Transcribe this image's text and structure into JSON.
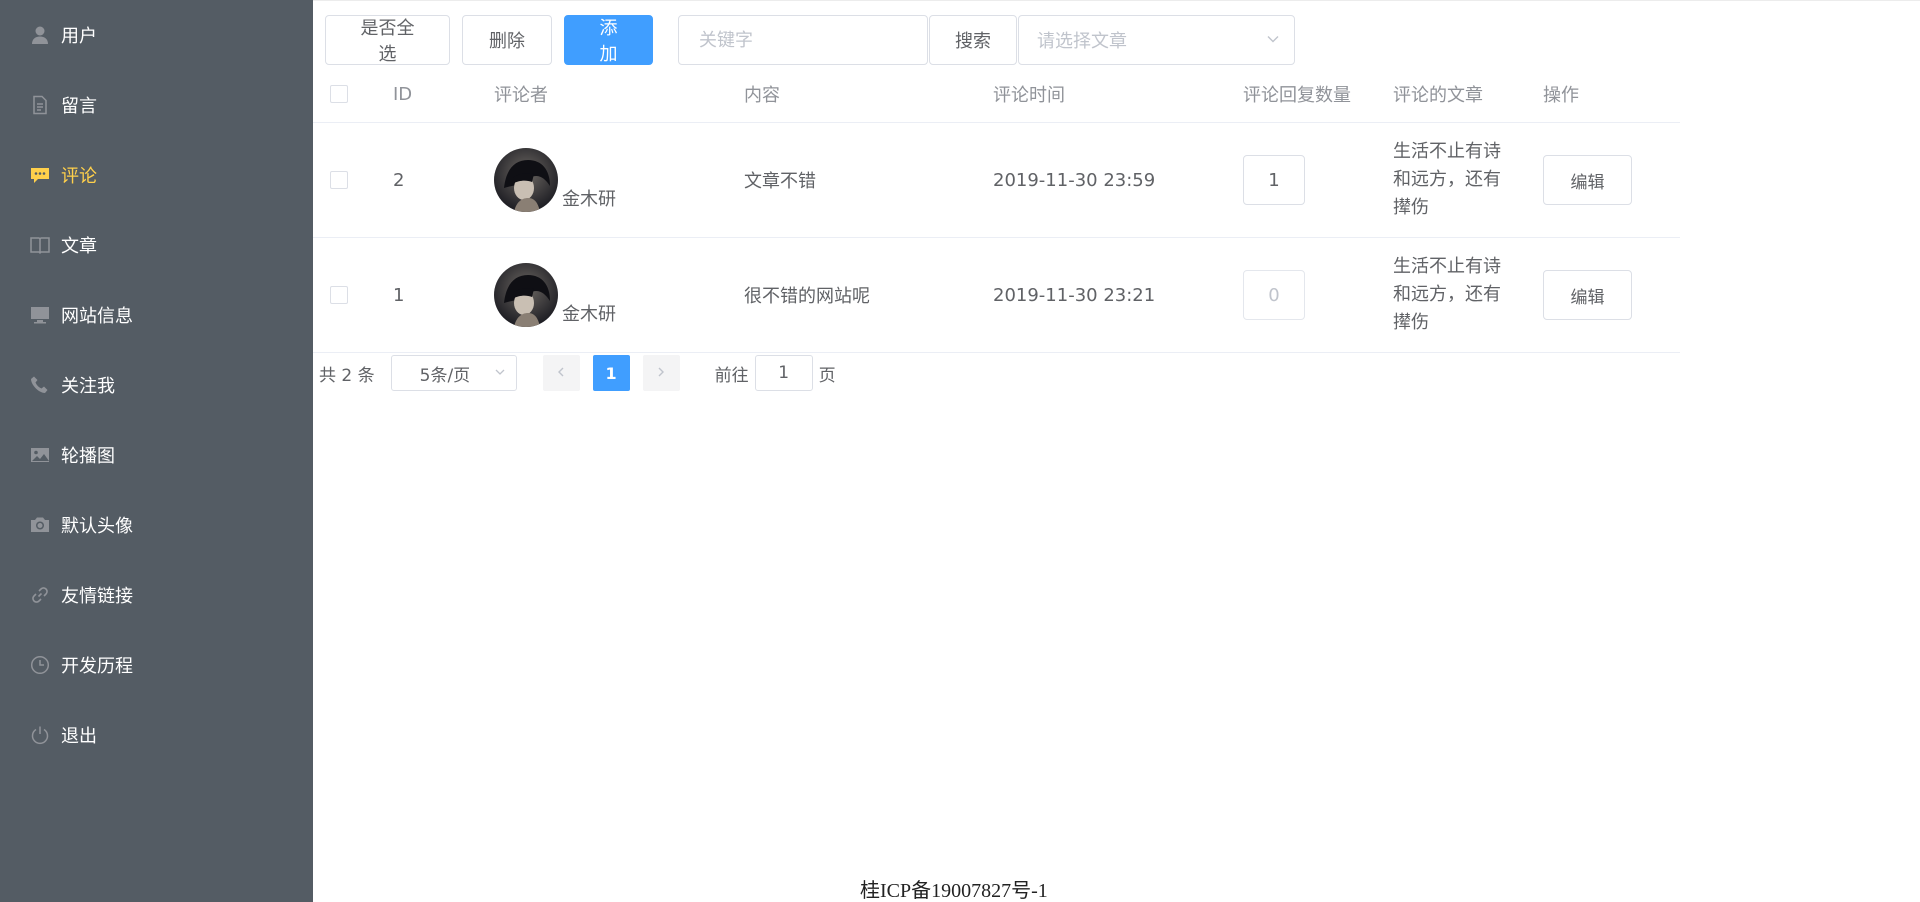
{
  "sidebar": {
    "items": [
      {
        "label": "用户",
        "icon": "user-icon",
        "active": false
      },
      {
        "label": "留言",
        "icon": "document-icon",
        "active": false
      },
      {
        "label": "评论",
        "icon": "chat-icon",
        "active": true
      },
      {
        "label": "文章",
        "icon": "book-icon",
        "active": false
      },
      {
        "label": "网站信息",
        "icon": "monitor-icon",
        "active": false
      },
      {
        "label": "关注我",
        "icon": "phone-icon",
        "active": false
      },
      {
        "label": "轮播图",
        "icon": "picture-icon",
        "active": false
      },
      {
        "label": "默认头像",
        "icon": "camera-icon",
        "active": false
      },
      {
        "label": "友情链接",
        "icon": "link-icon",
        "active": false
      },
      {
        "label": "开发历程",
        "icon": "clock-icon",
        "active": false
      },
      {
        "label": "退出",
        "icon": "power-icon",
        "active": false
      }
    ],
    "active_color": "#ffd04b",
    "background": "#545c64"
  },
  "toolbar": {
    "select_all_label": "是否全选",
    "delete_label": "删除",
    "add_label": "添加",
    "keyword_placeholder": "关键字",
    "search_label": "搜索",
    "article_select_placeholder": "请选择文章"
  },
  "table": {
    "headers": {
      "id": "ID",
      "commenter": "评论者",
      "content": "内容",
      "time": "评论时间",
      "reply_count": "评论回复数量",
      "article": "评论的文章",
      "actions": "操作"
    },
    "rows": [
      {
        "id": "2",
        "commenter": "金木研",
        "content": "文章不错",
        "time": "2019-11-30 23:59",
        "reply_count": "1",
        "reply_disabled": false,
        "article": "生活不止有诗和远方，还有撵伤",
        "edit_label": "编辑"
      },
      {
        "id": "1",
        "commenter": "金木研",
        "content": "很不错的网站呢",
        "time": "2019-11-30 23:21",
        "reply_count": "0",
        "reply_disabled": true,
        "article": "生活不止有诗和远方，还有撵伤",
        "edit_label": "编辑"
      }
    ]
  },
  "pagination": {
    "total_text": "共 2 条",
    "page_size": "5条/页",
    "current_page": "1",
    "goto_label": "前往",
    "goto_value": "1",
    "page_suffix": "页"
  },
  "footer": {
    "icp": "桂ICP备19007827号-1"
  },
  "colors": {
    "primary": "#409eff",
    "border": "#dcdfe6"
  }
}
